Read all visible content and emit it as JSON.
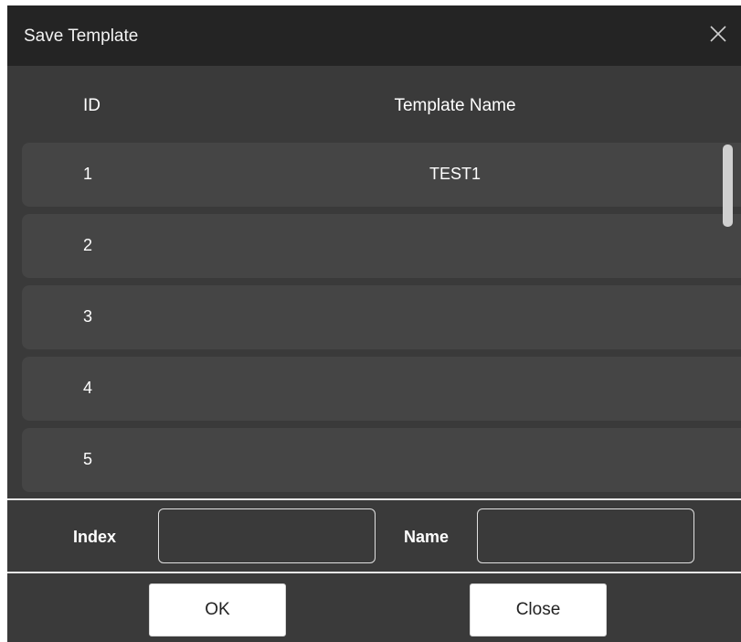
{
  "dialog": {
    "title": "Save Template",
    "close_icon": "close-icon"
  },
  "table": {
    "columns": [
      "ID",
      "Template Name"
    ],
    "rows": [
      {
        "id": "1",
        "name": "TEST1"
      },
      {
        "id": "2",
        "name": ""
      },
      {
        "id": "3",
        "name": ""
      },
      {
        "id": "4",
        "name": ""
      },
      {
        "id": "5",
        "name": ""
      }
    ]
  },
  "form": {
    "index_label": "Index",
    "index_value": "",
    "name_label": "Name",
    "name_value": ""
  },
  "buttons": {
    "ok_label": "OK",
    "close_label": "Close"
  },
  "colors": {
    "background": "#3a3a3a",
    "title_bar": "#242424",
    "row": "#454545",
    "text": "#ffffff"
  }
}
